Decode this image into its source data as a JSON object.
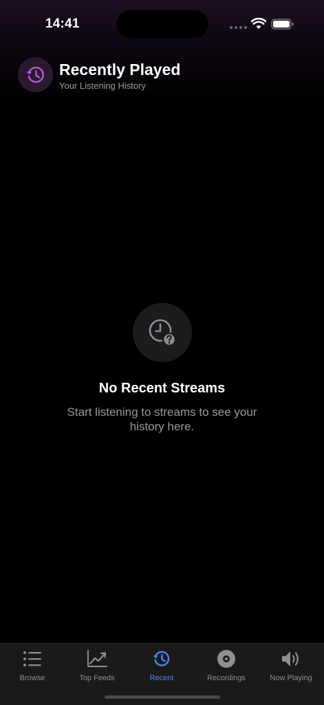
{
  "status_bar": {
    "time": "14:41"
  },
  "header": {
    "icon": "history-icon",
    "title": "Recently Played",
    "subtitle": "Your Listening History",
    "accent_color": "#b45cd6"
  },
  "empty_state": {
    "icon": "clock-question-icon",
    "title": "No Recent Streams",
    "message": "Start listening to streams to see your history here."
  },
  "tab_bar": {
    "active_color": "#4a86f7",
    "inactive_color": "#8e8e93",
    "items": [
      {
        "label": "Browse",
        "icon": "list-icon",
        "active": false
      },
      {
        "label": "Top Feeds",
        "icon": "chart-line-icon",
        "active": false
      },
      {
        "label": "Recent",
        "icon": "history-icon",
        "active": true
      },
      {
        "label": "Recordings",
        "icon": "record-disc-icon",
        "active": false
      },
      {
        "label": "Now Playing",
        "icon": "speaker-icon",
        "active": false
      }
    ]
  }
}
